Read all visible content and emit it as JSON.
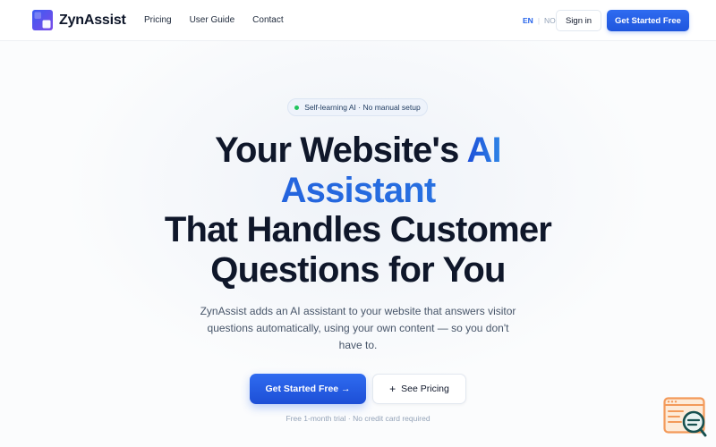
{
  "nav": {
    "brand": "ZynAssist",
    "links": [
      {
        "label": "Pricing"
      },
      {
        "label": "User Guide"
      },
      {
        "label": "Contact"
      }
    ],
    "lang": {
      "active": "EN",
      "separator": "|",
      "other": "NO"
    },
    "signin_label": "Sign in",
    "cta_label": "Get Started Free"
  },
  "hero": {
    "badge": "Self-learning AI · No manual setup",
    "headline": {
      "line1_plain": "Your Website's ",
      "line1_accent": "AI",
      "line2_accent": "Assistant",
      "line3": "That Handles Customer",
      "line4": "Questions for You"
    },
    "subtitle": "ZynAssist adds an AI assistant to your website that answers visitor questions automatically, using your own content — so you don't have to.",
    "primary_cta": "Get Started Free →",
    "secondary_cta": "See Pricing",
    "secondary_icon": "plus-icon",
    "note": "Free 1-month trial · No credit card required"
  },
  "widget": {
    "icon": "chat-widget-icon"
  },
  "colors": {
    "accent": "#2563eb",
    "accent_gradient_end": "#2f86e6",
    "badge_dot": "#22c55e",
    "widget_orange": "#f39a5a",
    "widget_teal": "#16504f"
  }
}
